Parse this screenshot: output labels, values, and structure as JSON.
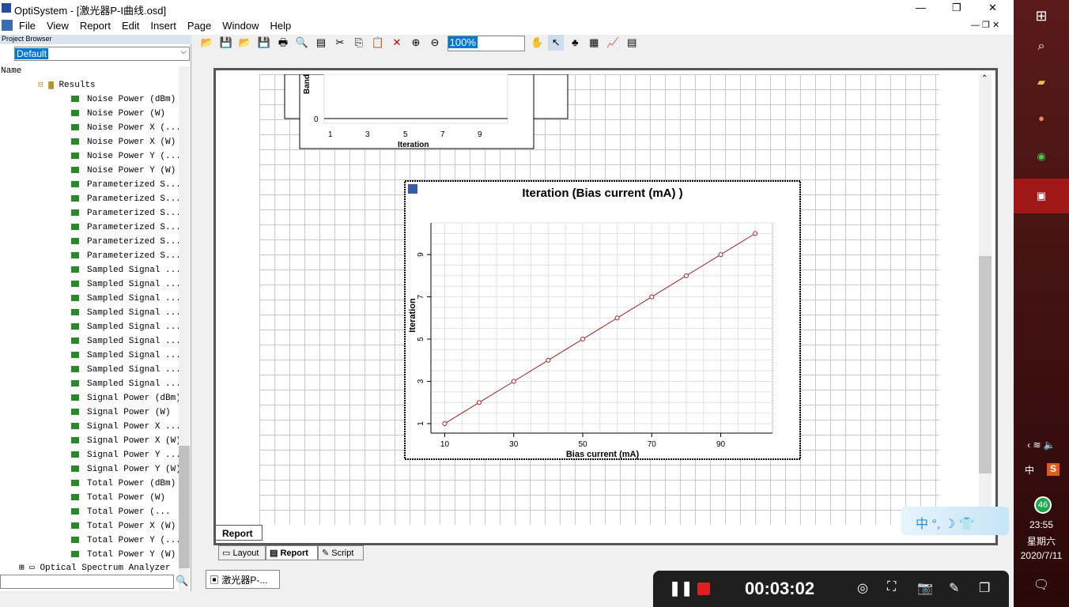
{
  "window": {
    "title": "OptiSystem - [激光器P-I曲线.osd]",
    "controls": [
      "—",
      "❐",
      "✕"
    ]
  },
  "menu": [
    "File",
    "View",
    "Report",
    "Edit",
    "Insert",
    "Page",
    "Window",
    "Help"
  ],
  "project_browser": {
    "title": "Project Browser",
    "selected": "Default",
    "column": "Name",
    "folder": "Results",
    "items": [
      "Noise Power (dBm)",
      "Noise Power (W)",
      "Noise Power X (...",
      "Noise Power X (W)",
      "Noise Power Y (...",
      "Noise Power Y (W)",
      "Parameterized S...",
      "Parameterized S...",
      "Parameterized S...",
      "Parameterized S...",
      "Parameterized S...",
      "Parameterized S...",
      "Sampled Signal ...",
      "Sampled Signal ...",
      "Sampled Signal ...",
      "Sampled Signal ...",
      "Sampled Signal ...",
      "Sampled Signal ...",
      "Sampled Signal ...",
      "Sampled Signal ...",
      "Sampled Signal ...",
      "Signal Power (dBm)",
      "Signal Power (W)",
      "Signal Power X ...",
      "Signal Power X (W)",
      "Signal Power Y ...",
      "Signal Power Y (W)",
      "Total Power (dBm)",
      "Total Power (W)",
      "Total Power (...",
      "Total Power X (W)",
      "Total Power Y (...",
      "Total Power Y (W)"
    ],
    "next_node": "Optical Spectrum Analyzer"
  },
  "toolbar": {
    "zoom": "100%"
  },
  "report_tab": "Report",
  "view_tabs": [
    "Layout",
    "Report",
    "Script"
  ],
  "doc_tab": "激光器P-...",
  "prev_chart": {
    "ylabel": "Band",
    "xlabel": "Iteration",
    "xticks": [
      "1",
      "3",
      "5",
      "7",
      "9"
    ],
    "ytick": "0"
  },
  "chart_data": {
    "type": "line",
    "title": "Iteration (Bias current (mA) )",
    "xlabel": "Bias current (mA)",
    "ylabel": "Iteration",
    "x": [
      10,
      20,
      30,
      40,
      50,
      60,
      70,
      80,
      90,
      100
    ],
    "y": [
      1,
      2,
      3,
      4,
      5,
      6,
      7,
      8,
      9,
      10
    ],
    "xticks": [
      "10",
      "30",
      "50",
      "70",
      "90"
    ],
    "yticks": [
      "1",
      "3",
      "5",
      "7",
      "9"
    ],
    "xlim": [
      6,
      105
    ],
    "ylim": [
      0.55,
      10.5
    ],
    "grid": true,
    "color": "#a02020"
  },
  "tray": {
    "ime": "中",
    "badge": "46",
    "time": "23:55",
    "day": "星期六",
    "date": "2020/7/11"
  },
  "ime_bar": {
    "lang": "中"
  },
  "recorder": {
    "timer": "00:03:02"
  }
}
